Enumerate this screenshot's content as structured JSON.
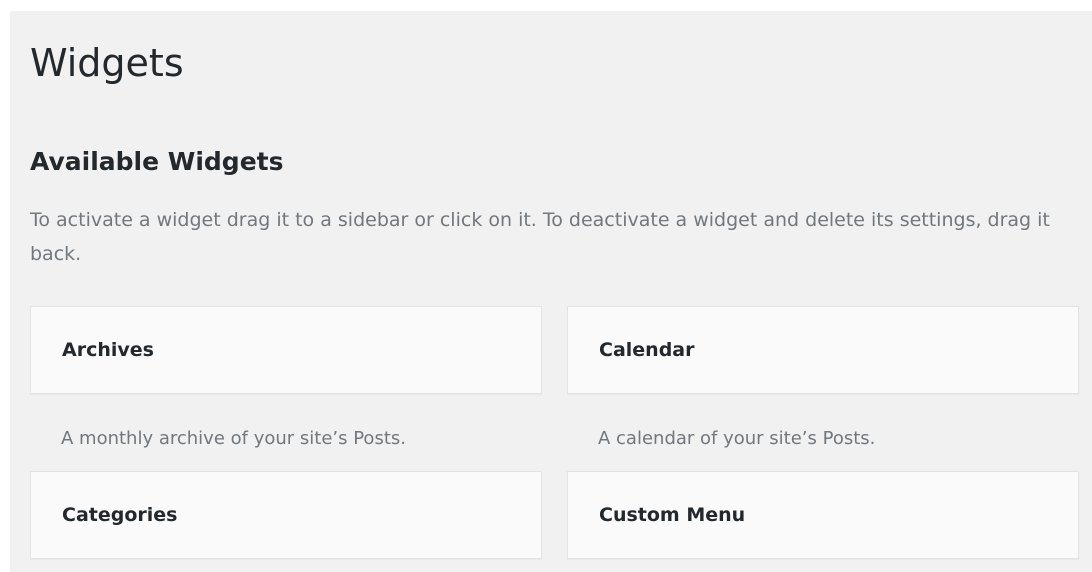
{
  "page": {
    "title": "Widgets"
  },
  "available": {
    "heading": "Available Widgets",
    "description": "To activate a widget drag it to a sidebar or click on it. To deactivate a widget and delete its settings, drag it back."
  },
  "widgets": [
    {
      "title": "Archives",
      "description": "A monthly archive of your site’s Posts."
    },
    {
      "title": "Calendar",
      "description": "A calendar of your site’s Posts."
    },
    {
      "title": "Categories",
      "description": ""
    },
    {
      "title": "Custom Menu",
      "description": ""
    }
  ],
  "colors": {
    "background": "#f1f1f1",
    "card": "#fafafa",
    "text": "#23282d",
    "muted": "#72777c"
  }
}
